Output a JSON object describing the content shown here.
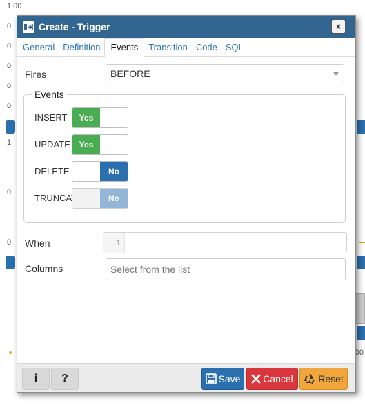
{
  "background": {
    "axis_top": "1.00",
    "axis_ticks": [
      "0",
      "0",
      "0",
      "0",
      "0",
      "1",
      "0",
      "0"
    ],
    "right_zero": "00"
  },
  "dialog": {
    "title": "Create - Trigger",
    "close_label": "×",
    "tabs": [
      {
        "label": "General"
      },
      {
        "label": "Definition"
      },
      {
        "label": "Events"
      },
      {
        "label": "Transition"
      },
      {
        "label": "Code"
      },
      {
        "label": "SQL"
      }
    ],
    "active_tab": "Events",
    "fires": {
      "label": "Fires",
      "value": "BEFORE"
    },
    "events": {
      "legend": "Events",
      "items": [
        {
          "label": "INSERT",
          "value": "Yes",
          "disabled": false
        },
        {
          "label": "UPDATE",
          "value": "Yes",
          "disabled": false
        },
        {
          "label": "DELETE",
          "value": "No",
          "disabled": false
        },
        {
          "label": "TRUNCATE",
          "value": "No",
          "disabled": true
        }
      ]
    },
    "when": {
      "label": "When",
      "line_number": "1",
      "value": ""
    },
    "columns": {
      "label": "Columns",
      "placeholder": "Select from the list"
    },
    "footer": {
      "info_label": "i",
      "help_label": "?",
      "save_label": "Save",
      "cancel_label": "Cancel",
      "reset_label": "Reset"
    },
    "colors": {
      "title_bar": "#326690",
      "yes": "#4aad52",
      "no": "#2a6fae",
      "save": "#2a6fae",
      "cancel": "#d9363e",
      "reset": "#f0a63a"
    }
  }
}
